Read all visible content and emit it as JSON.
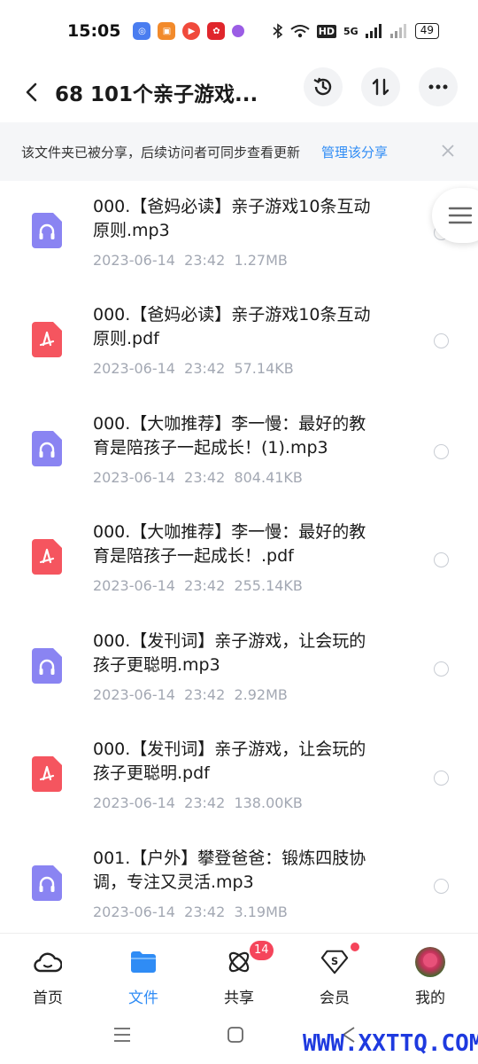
{
  "status": {
    "time": "15:05",
    "hd": "HD",
    "net": "5G",
    "battery": "49"
  },
  "header": {
    "title": "68 101个亲子游戏..."
  },
  "banner": {
    "text": "该文件夹已被分享，后续访问者可同步查看更新",
    "link": "管理该分享"
  },
  "files": [
    {
      "name_l1": "000.【爸妈必读】亲子游戏10条互动",
      "name_l2": "原则.mp3",
      "meta": "2023-06-14  23:42  1.27MB",
      "type": "audio"
    },
    {
      "name_l1": "000.【爸妈必读】亲子游戏10条互动",
      "name_l2": "原则.pdf",
      "meta": "2023-06-14  23:42  57.14KB",
      "type": "pdf"
    },
    {
      "name_l1": "000.【大咖推荐】李一慢：最好的教",
      "name_l2": "育是陪孩子一起成长！(1).mp3",
      "meta": "2023-06-14  23:42  804.41KB",
      "type": "audio"
    },
    {
      "name_l1": "000.【大咖推荐】李一慢：最好的教",
      "name_l2": "育是陪孩子一起成长！.pdf",
      "meta": "2023-06-14  23:42  255.14KB",
      "type": "pdf"
    },
    {
      "name_l1": "000.【发刊词】亲子游戏，让会玩的",
      "name_l2": "孩子更聪明.mp3",
      "meta": "2023-06-14  23:42  2.92MB",
      "type": "audio"
    },
    {
      "name_l1": "000.【发刊词】亲子游戏，让会玩的",
      "name_l2": "孩子更聪明.pdf",
      "meta": "2023-06-14  23:42  138.00KB",
      "type": "pdf"
    },
    {
      "name_l1": "001.【户外】攀登爸爸：锻炼四肢协",
      "name_l2": "调，专注又灵活.mp3",
      "meta": "2023-06-14  23:42  3.19MB",
      "type": "audio"
    }
  ],
  "nav": {
    "home": "首页",
    "files": "文件",
    "share": "共享",
    "share_badge": "14",
    "vip": "会员",
    "me": "我的"
  },
  "watermark": "WWW.XXTTQ.COM",
  "colors": {
    "accent": "#2f8cf5",
    "audio_icon": "#8a84f2",
    "pdf_icon": "#f5555f",
    "badge": "#f5455b"
  }
}
